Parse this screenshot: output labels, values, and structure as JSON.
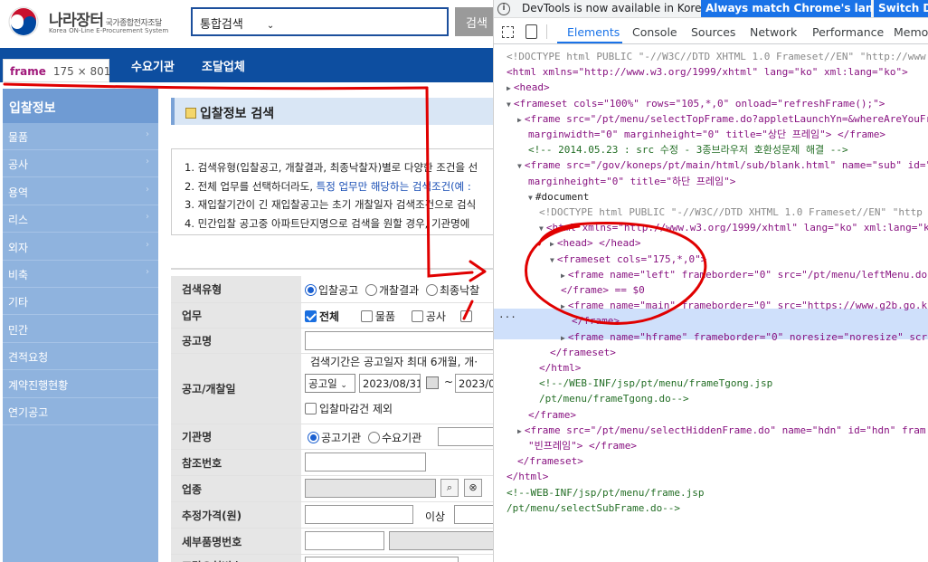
{
  "site": {
    "logo": {
      "title": "나라장터",
      "subtitle": "국가종합전자조달",
      "english": "Korea ON-Line E-Procurement System"
    },
    "search": {
      "scope": "통합검색",
      "button": "검색"
    },
    "topnav": {
      "item1": "수요기관",
      "item2": "조달업체"
    },
    "frame_tooltip": {
      "name": "frame",
      "size": "175 × 801"
    },
    "left_menu": {
      "header": "입찰정보",
      "items": [
        "물품",
        "공사",
        "용역",
        "리스",
        "외자",
        "비축",
        "기타",
        "민간",
        "견적요청",
        "계약진행현황",
        "연기공고"
      ]
    },
    "page_title": "입찰정보 검색",
    "notice": {
      "line1": "1. 검색유형(입찰공고, 개찰결과, 최종낙찰자)별로 다양한 조건을 선",
      "line2_a": "2. 전체 업무를 선택하더라도, ",
      "line2_b": "특정 업무만 해당하는 검색조건(예 :",
      "line3": "3. 재입찰기간이 긴 재입찰공고는 초기 개찰일자 검색조건으로 검식",
      "line4": "4. 민간입찰 공고중 아파트단지명으로 검색을 원할 경우, 기관명에"
    },
    "form": {
      "search_type": {
        "label": "검색유형",
        "opt1": "입찰공고",
        "opt2": "개찰결과",
        "opt3": "최종낙찰"
      },
      "business": {
        "label": "업무",
        "all": "전체",
        "goods": "물품",
        "construction": "공사"
      },
      "notice_name": {
        "label": "공고명"
      },
      "period": {
        "label": "공고/개찰일",
        "hint": "검색기간은 공고일자 최대 6개월, 개·",
        "select": "공고일",
        "from": "2023/08/31",
        "tilde": "~",
        "to": "2023/0",
        "deadline_exclude": "입찰마감건 제외"
      },
      "agency": {
        "label": "기관명",
        "opt1": "공고기관",
        "opt2": "수요기관"
      },
      "ref_no": {
        "label": "참조번호"
      },
      "industry": {
        "label": "업종"
      },
      "est_price": {
        "label": "추정가격(원)",
        "above": "이상"
      },
      "detail_item": {
        "label": "세부품명번호"
      },
      "procure_req": {
        "label": "조달요청번호/PR-No"
      }
    }
  },
  "devtools": {
    "banner": {
      "message": "DevTools is now available in Korean!",
      "btn1": "Always match Chrome's language",
      "btn2": "Switch De"
    },
    "tabs": [
      "Elements",
      "Console",
      "Sources",
      "Network",
      "Performance",
      "Memor"
    ],
    "active_tab": "Elements",
    "lines": [
      {
        "t": "<!DOCTYPE html PUBLIC \"-//W3C//DTD XHTML 1.0 Frameset//EN\" \"http://www.w3."
      },
      {
        "t": "<html xmlns=\"http://www.w3.org/1999/xhtml\" lang=\"ko\" xml:lang=\"ko\">"
      },
      {
        "t": "<head>"
      },
      {
        "t": "<frameset cols=\"100%\" rows=\"105,*,0\" onload=\"refreshFrame();\">"
      },
      {
        "t": "<frame src=\"/pt/menu/selectTopFrame.do?appletLaunchYn=&whereAreYouFr"
      },
      {
        "t": "marginwidth=\"0\" marginheight=\"0\" title=\"상단 프레임\"> </frame>"
      },
      {
        "t": "<!-- 2014.05.23 : src 수정 - 3종브라우저 호환성문제 해결 -->"
      },
      {
        "t": "<frame src=\"/gov/koneps/pt/main/html/sub/blank.html\" name=\"sub\" id=\""
      },
      {
        "t": "marginheight=\"0\" title=\"하단 프레임\">"
      },
      {
        "t": "#document"
      },
      {
        "t": "<!DOCTYPE html PUBLIC \"-//W3C//DTD XHTML 1.0 Frameset//EN\" \"http"
      },
      {
        "t": "<html xmlns=\"http://www.w3.org/1999/xhtml\" lang=\"ko\" xml:lang=\"k"
      },
      {
        "t": "<head> </head>"
      },
      {
        "t": "<frameset cols=\"175,*,0\">"
      },
      {
        "t": "<frame name=\"left\" frameborder=\"0\" src=\"/pt/menu/leftMenu.do"
      },
      {
        "t": "</frame> == $0"
      },
      {
        "t": "<frame name=\"main\" frameborder=\"0\" src=\"https://www.g2b.go.k"
      },
      {
        "t": "</frame>"
      },
      {
        "t": "<frame name=\"hframe\" frameborder=\"0\" noresize=\"noresize\" scr"
      },
      {
        "t": "</frameset>"
      },
      {
        "t": "</html>"
      },
      {
        "t": "<!--/WEB-INF/jsp/pt/menu/frameTgong.jsp"
      },
      {
        "t": "/pt/menu/frameTgong.do-->"
      },
      {
        "t": "</frame>"
      },
      {
        "t": "<frame src=\"/pt/menu/selectHiddenFrame.do\" name=\"hdn\" id=\"hdn\" fram"
      },
      {
        "t": "\"빈프레임\"> </frame>"
      },
      {
        "t": "</frameset>"
      },
      {
        "t": "</html>"
      },
      {
        "t": "<!--WEB-INF/jsp/pt/menu/frame.jsp"
      },
      {
        "t": "/pt/menu/selectSubFrame.do-->"
      }
    ]
  },
  "colors": {
    "brand_blue": "#0d4ea0",
    "annotation_red": "#e00000",
    "devtools_accent": "#1a73e8"
  }
}
